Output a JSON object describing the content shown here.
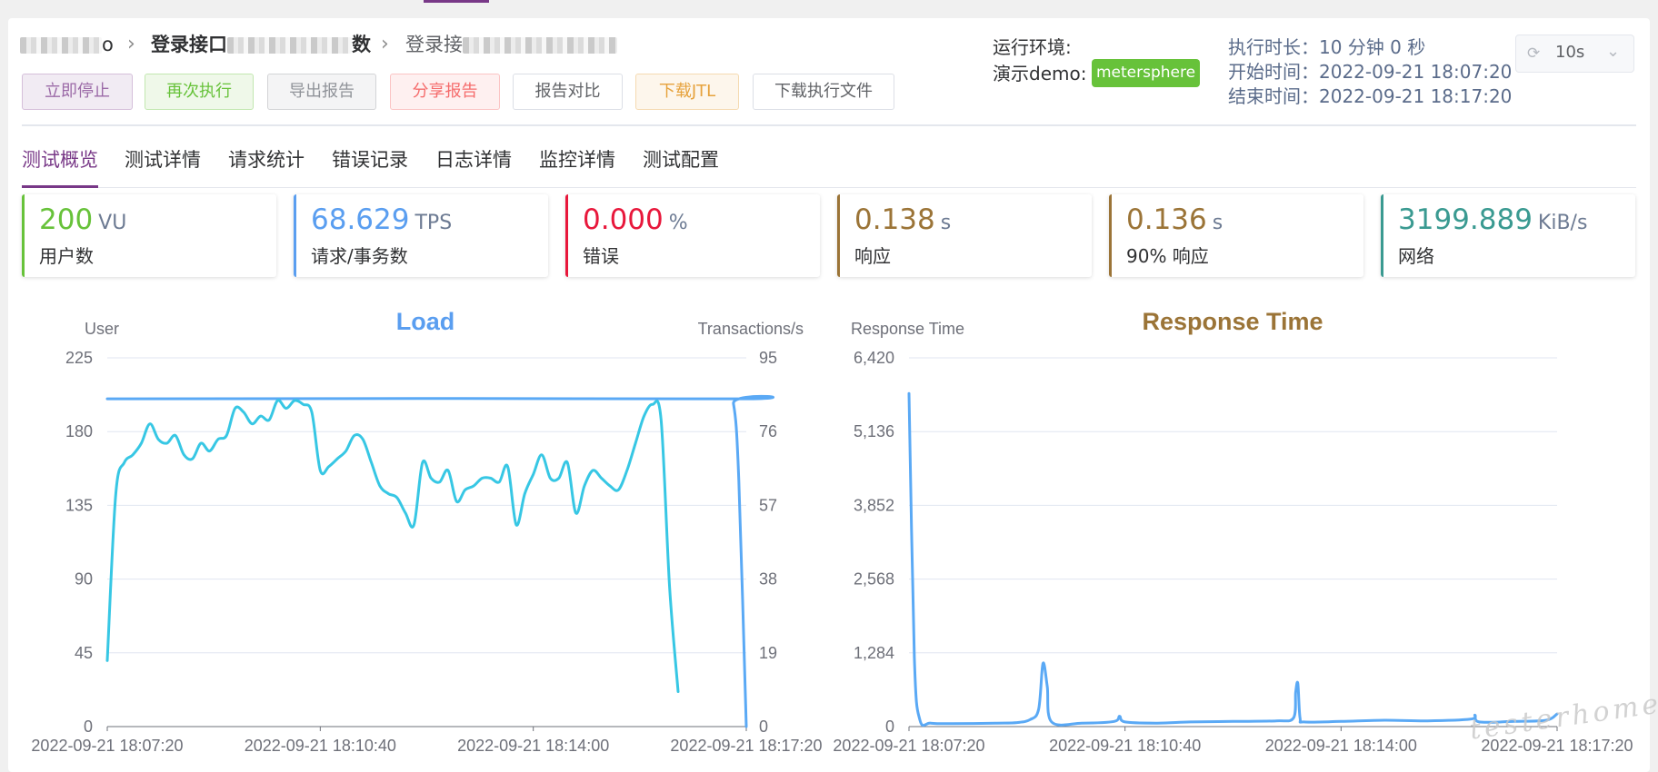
{
  "breadcrumb": {
    "item1": "o",
    "item2_prefix": "登录接口",
    "item2_suffix": "数",
    "item3_prefix": "登录接"
  },
  "toolbar": {
    "stop": "立即停止",
    "rerun": "再次执行",
    "export": "导出报告",
    "share": "分享报告",
    "compare": "报告对比",
    "download_jtl": "下载JTL",
    "download_files": "下载执行文件"
  },
  "env": {
    "label": "运行环境:",
    "name": "演示demo:",
    "tag": "metersphere"
  },
  "timing": {
    "duration": "执行时长：10 分钟 0 秒",
    "start": "开始时间：2022-09-21 18:07:20",
    "end": "结束时间：2022-09-21 18:17:20"
  },
  "refresh": {
    "icon": "refresh-icon",
    "value": "10s"
  },
  "tabs": [
    "测试概览",
    "测试详情",
    "请求统计",
    "错误记录",
    "日志详情",
    "监控详情",
    "测试配置"
  ],
  "stats": [
    {
      "value": "200",
      "unit": "VU",
      "label": "用户数",
      "color": "#67c23a"
    },
    {
      "value": "68.629",
      "unit": "TPS",
      "label": "请求/事务数",
      "color": "#5a9ef0"
    },
    {
      "value": "0.000",
      "unit": "%",
      "label": "错误",
      "color": "#e8173b"
    },
    {
      "value": "0.138",
      "unit": "s",
      "label": "响应",
      "color": "#9b7437"
    },
    {
      "value": "0.136",
      "unit": "s",
      "label": "90% 响应",
      "color": "#9b7437"
    },
    {
      "value": "3199.889",
      "unit": "KiB/s",
      "label": "网络",
      "color": "#3a9a91"
    }
  ],
  "colors": {
    "accent": "#783887",
    "load_title": "#5a9ef0",
    "rt_title": "#9b7437",
    "users_line": "#5aa9f5",
    "tps_line": "#37c7e4",
    "rt_line": "#5aa9f5"
  },
  "watermark": "testerhome",
  "chart_data": [
    {
      "type": "line",
      "title": "Load",
      "ylabel": "User",
      "y2label": "Transactions/s",
      "x": [
        "2022-09-21 18:07:20",
        "2022-09-21 18:10:40",
        "2022-09-21 18:14:00",
        "2022-09-21 18:17:20"
      ],
      "xlim": [
        "2022-09-21 18:07:20",
        "2022-09-21 18:17:20"
      ],
      "ylim": [
        0,
        225
      ],
      "y_ticks": [
        "0",
        "45",
        "90",
        "135",
        "180",
        "225"
      ],
      "y2lim": [
        0,
        95
      ],
      "y2_ticks": [
        "0",
        "19",
        "38",
        "57",
        "76",
        "95"
      ],
      "grid": true,
      "series": [
        {
          "axis": "left",
          "points": [
            [
              0,
              200
            ],
            [
              580,
              200
            ],
            [
              588,
              197
            ],
            [
              593,
              150
            ],
            [
              600,
              0
            ]
          ]
        },
        {
          "axis": "right",
          "points": [
            [
              0,
              17
            ],
            [
              8,
              60
            ],
            [
              16,
              68
            ],
            [
              24,
              70
            ],
            [
              32,
              73
            ],
            [
              40,
              78
            ],
            [
              48,
              74
            ],
            [
              56,
              73
            ],
            [
              64,
              75
            ],
            [
              72,
              70
            ],
            [
              80,
              69
            ],
            [
              88,
              73
            ],
            [
              96,
              71
            ],
            [
              104,
              74
            ],
            [
              112,
              75
            ],
            [
              120,
              82
            ],
            [
              128,
              81
            ],
            [
              136,
              78
            ],
            [
              144,
              80
            ],
            [
              152,
              79
            ],
            [
              160,
              84
            ],
            [
              168,
              82
            ],
            [
              176,
              84
            ],
            [
              184,
              83
            ],
            [
              192,
              81
            ],
            [
              200,
              66
            ],
            [
              208,
              67
            ],
            [
              216,
              69
            ],
            [
              224,
              71
            ],
            [
              232,
              75
            ],
            [
              240,
              74
            ],
            [
              248,
              68
            ],
            [
              256,
              62
            ],
            [
              264,
              60
            ],
            [
              272,
              59
            ],
            [
              280,
              55
            ],
            [
              288,
              52
            ],
            [
              296,
              68
            ],
            [
              304,
              64
            ],
            [
              312,
              63
            ],
            [
              320,
              66
            ],
            [
              328,
              58
            ],
            [
              336,
              61
            ],
            [
              344,
              62
            ],
            [
              352,
              64
            ],
            [
              360,
              64
            ],
            [
              368,
              63
            ],
            [
              376,
              67
            ],
            [
              384,
              52
            ],
            [
              392,
              60
            ],
            [
              400,
              65
            ],
            [
              408,
              70
            ],
            [
              416,
              64
            ],
            [
              424,
              64
            ],
            [
              432,
              68
            ],
            [
              440,
              55
            ],
            [
              448,
              62
            ],
            [
              456,
              66
            ],
            [
              464,
              64
            ],
            [
              472,
              62
            ],
            [
              480,
              61
            ],
            [
              488,
              66
            ],
            [
              496,
              73
            ],
            [
              504,
              80
            ],
            [
              512,
              83
            ],
            [
              520,
              79
            ],
            [
              528,
              36
            ],
            [
              536,
              9
            ]
          ]
        }
      ]
    },
    {
      "type": "line",
      "title": "Response Time",
      "ylabel": "Response Time",
      "x": [
        "2022-09-21 18:07:20",
        "2022-09-21 18:10:40",
        "2022-09-21 18:14:00",
        "2022-09-21 18:17:20"
      ],
      "xlim": [
        "2022-09-21 18:07:20",
        "2022-09-21 18:17:20"
      ],
      "ylim": [
        0,
        6420
      ],
      "y_ticks": [
        "0",
        "1,284",
        "2,568",
        "3,852",
        "5,136",
        "6,420"
      ],
      "grid": true,
      "series": [
        {
          "points": [
            [
              0,
              5800
            ],
            [
              5,
              1200
            ],
            [
              10,
              120
            ],
            [
              20,
              60
            ],
            [
              40,
              50
            ],
            [
              80,
              60
            ],
            [
              100,
              70
            ],
            [
              112,
              120
            ],
            [
              120,
              300
            ],
            [
              124,
              1100
            ],
            [
              128,
              700
            ],
            [
              132,
              80
            ],
            [
              160,
              60
            ],
            [
              190,
              90
            ],
            [
              195,
              180
            ],
            [
              200,
              80
            ],
            [
              230,
              60
            ],
            [
              260,
              80
            ],
            [
              300,
              90
            ],
            [
              340,
              100
            ],
            [
              356,
              150
            ],
            [
              358,
              600
            ],
            [
              360,
              750
            ],
            [
              362,
              150
            ],
            [
              366,
              80
            ],
            [
              400,
              90
            ],
            [
              440,
              110
            ],
            [
              480,
              100
            ],
            [
              520,
              130
            ],
            [
              524,
              200
            ],
            [
              528,
              80
            ],
            [
              560,
              90
            ],
            [
              590,
              110
            ],
            [
              600,
              220
            ]
          ]
        }
      ]
    }
  ]
}
